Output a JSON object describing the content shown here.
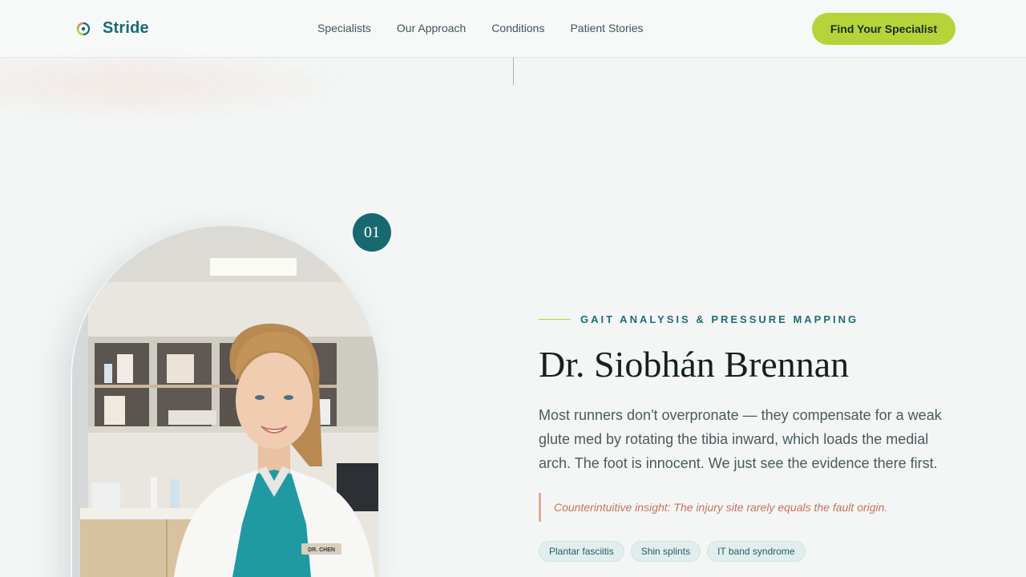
{
  "brand": {
    "name": "Stride",
    "accent": "#1a6a72",
    "cta_color": "#b6d43a"
  },
  "nav": {
    "items": [
      {
        "label": "Specialists"
      },
      {
        "label": "Our Approach"
      },
      {
        "label": "Conditions"
      },
      {
        "label": "Patient Stories"
      }
    ],
    "cta_label": "Find Your Specialist"
  },
  "specialist": {
    "index": "01",
    "specialty": "GAIT ANALYSIS & PRESSURE MAPPING",
    "name": "Dr. Siobhán Brennan",
    "bio": "Most runners don't overpronate — they compensate for a weak glute med by rotating the tibia inward, which loads the medial arch. The foot is innocent. We just see the evidence there first.",
    "insight": "Counterintuitive insight: The injury site rarely equals the fault origin.",
    "name_tag": "DR. CHEN",
    "conditions": [
      {
        "label": "Plantar fasciitis"
      },
      {
        "label": "Shin splints"
      },
      {
        "label": "IT band syndrome"
      }
    ]
  },
  "icons": {
    "logo": "stride-logo-icon"
  }
}
